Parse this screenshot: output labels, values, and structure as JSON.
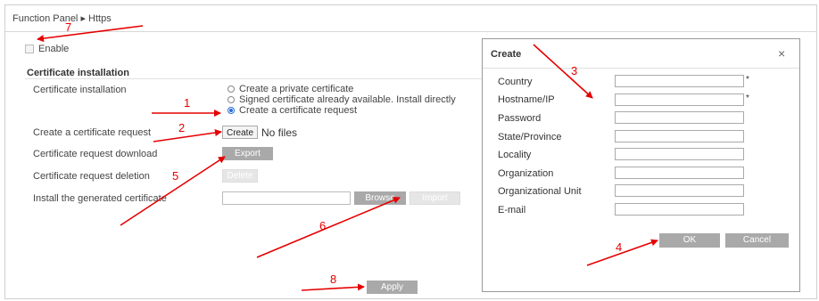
{
  "breadcrumb": {
    "root": "Function Panel",
    "sep": "▸",
    "current": "Https"
  },
  "enable_label": "Enable",
  "section_title": "Certificate installation",
  "rows": {
    "cert_install": "Certificate installation",
    "create_request": "Create a certificate request",
    "request_download": "Certificate request download",
    "request_deletion": "Certificate request deletion",
    "install_generated": "Install the generated certificate"
  },
  "radios": [
    {
      "label": "Create a private certificate",
      "selected": false
    },
    {
      "label": "Signed certificate already available. Install directly",
      "selected": false
    },
    {
      "label": "Create a certificate request",
      "selected": true
    }
  ],
  "buttons": {
    "create": "Create",
    "no_files": "No files",
    "export": "Export",
    "delete": "Delete",
    "browse": "Browse",
    "import": "Import",
    "apply": "Apply"
  },
  "dialog": {
    "title": "Create",
    "close": "×",
    "fields": [
      {
        "label": "Country",
        "required": true
      },
      {
        "label": "Hostname/IP",
        "required": true
      },
      {
        "label": "Password",
        "required": false
      },
      {
        "label": "State/Province",
        "required": false
      },
      {
        "label": "Locality",
        "required": false
      },
      {
        "label": "Organization",
        "required": false
      },
      {
        "label": "Organizational Unit",
        "required": false
      },
      {
        "label": "E-mail",
        "required": false
      }
    ],
    "required_mark": "*",
    "ok": "OK",
    "cancel": "Cancel"
  },
  "annotations": [
    "1",
    "2",
    "3",
    "4",
    "5",
    "6",
    "7",
    "8"
  ],
  "colors": {
    "annotation": "#e60000",
    "selected_radio": "#2a6dd6",
    "button_gray": "#a9a9a9"
  }
}
